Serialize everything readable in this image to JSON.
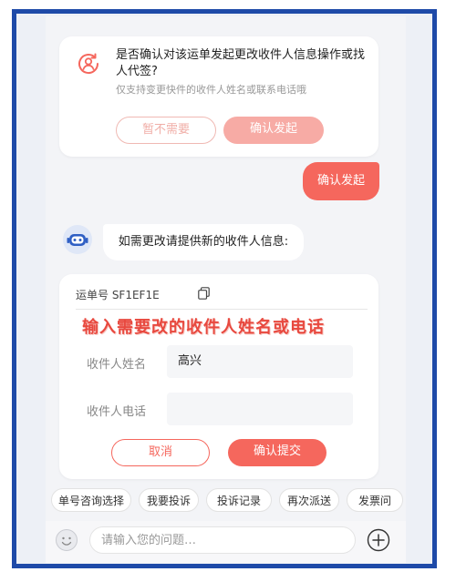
{
  "confirm_card": {
    "title": "是否确认对该运单发起更改收件人信息操作或找人代签?",
    "subtitle": "仅支持变更快件的收件人姓名或联系电话哦",
    "cancel_label": "暂不需要",
    "confirm_label": "确认发起"
  },
  "user_message": "确认发起",
  "bot_message": "如需更改请提供新的收件人信息:",
  "form": {
    "waybill_label": "运单号 SF1EF1E",
    "overlay_caption": "输入需要改的收件人姓名或电话",
    "name_label": "收件人姓名",
    "name_value": "高兴",
    "phone_label": "收件人电话",
    "phone_value": "",
    "cancel_label": "取消",
    "submit_label": "确认提交"
  },
  "quick_actions": [
    "单号咨询选择",
    "我要投诉",
    "投诉记录",
    "再次派送",
    "发票问"
  ],
  "chat_input": {
    "placeholder": "请输入您的问题…"
  },
  "colors": {
    "accent": "#f5675d",
    "accent_light": "#f7aba5",
    "frame_border": "#1e4aa8",
    "overlay_text": "#e8493f"
  }
}
